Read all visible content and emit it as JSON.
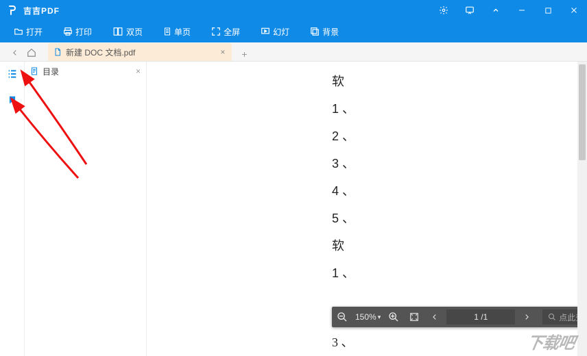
{
  "app": {
    "title": "吉吉PDF"
  },
  "titlebarControls": {
    "settings": "settings",
    "feedback": "feedback",
    "collapse": "collapse",
    "min": "min",
    "max": "max",
    "close": "close"
  },
  "toolbar": {
    "open": "打开",
    "print": "打印",
    "dual": "双页",
    "single": "单页",
    "full": "全屏",
    "slide": "幻灯",
    "bg": "背景"
  },
  "tabs": {
    "active": {
      "name": "新建 DOC 文档.pdf",
      "close": "×"
    },
    "add": "+"
  },
  "sidepanel": {
    "title": "目录",
    "close": "×"
  },
  "document": {
    "lines": [
      "软",
      "1 、",
      "2 、",
      "3 、",
      "4 、",
      "5 、",
      "软",
      "1 、"
    ],
    "belowCtrl": "3 、"
  },
  "pagectrl": {
    "zoom": "150%",
    "dropdown": "▾",
    "pagecur": "1",
    "pagesep": "/",
    "pagetot": "1",
    "search_placeholder": "点此查找文本"
  },
  "watermark": "下载吧"
}
